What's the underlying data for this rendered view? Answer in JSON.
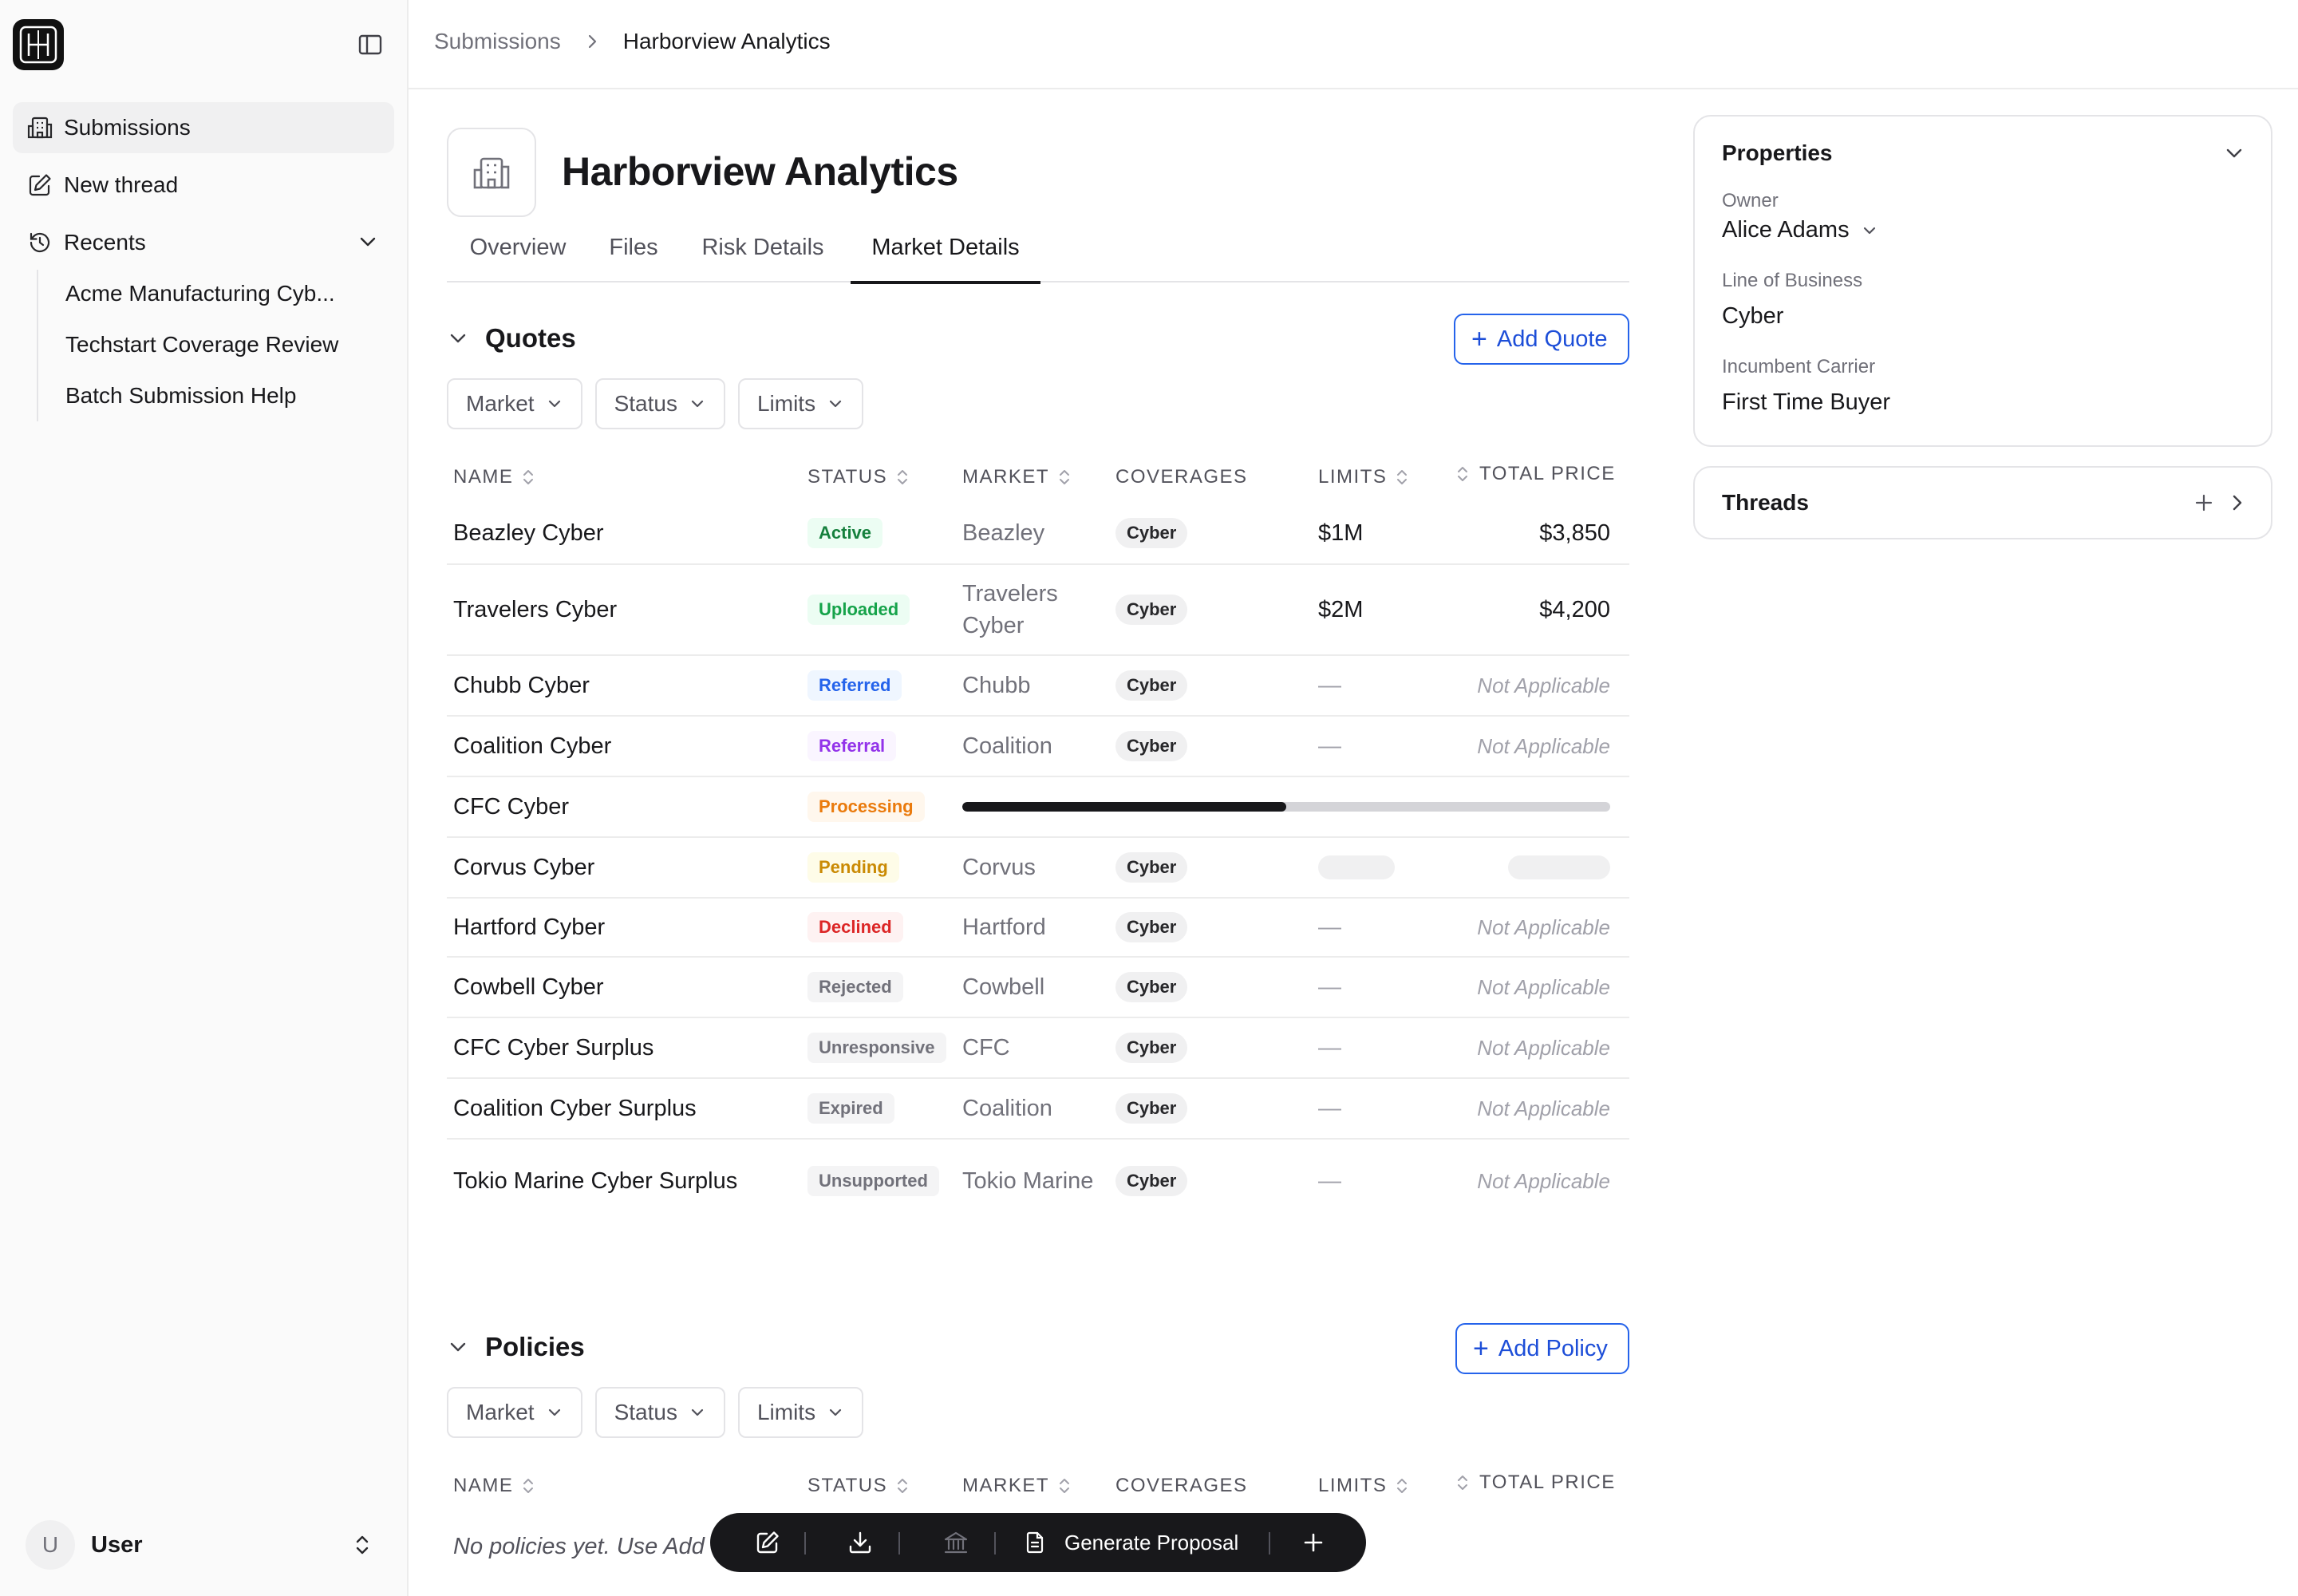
{
  "sidebar": {
    "nav": [
      {
        "label": "Submissions",
        "icon": "building-icon"
      },
      {
        "label": "New thread",
        "icon": "edit-icon"
      },
      {
        "label": "Recents",
        "icon": "history-icon"
      }
    ],
    "recents": [
      "Acme Manufacturing Cyb...",
      "Techstart Coverage Review",
      "Batch Submission Help"
    ],
    "user": {
      "initial": "U",
      "name": "User"
    }
  },
  "breadcrumb": {
    "parent": "Submissions",
    "current": "Harborview Analytics"
  },
  "page": {
    "title": "Harborview Analytics",
    "tabs": [
      "Overview",
      "Files",
      "Risk Details",
      "Market Details"
    ],
    "active_tab": "Market Details"
  },
  "quotes": {
    "title": "Quotes",
    "add_label": "Add Quote",
    "filters": [
      "Market",
      "Status",
      "Limits"
    ],
    "columns": [
      "NAME",
      "STATUS",
      "MARKET",
      "COVERAGES",
      "LIMITS",
      "TOTAL PRICE"
    ],
    "rows": [
      {
        "name": "Beazley Cyber",
        "status": "Active",
        "market": "Beazley",
        "coverage": "Cyber",
        "limits": "$1M",
        "price": "$3,850"
      },
      {
        "name": "Travelers Cyber",
        "status": "Uploaded",
        "market": "Travelers Cyber",
        "coverage": "Cyber",
        "limits": "$2M",
        "price": "$4,200"
      },
      {
        "name": "Chubb Cyber",
        "status": "Referred",
        "market": "Chubb",
        "coverage": "Cyber",
        "limits": "—",
        "price": "Not Applicable"
      },
      {
        "name": "Coalition Cyber",
        "status": "Referral",
        "market": "Coalition",
        "coverage": "Cyber",
        "limits": "—",
        "price": "Not Applicable"
      },
      {
        "name": "CFC Cyber",
        "status": "Processing",
        "progress": 0.5
      },
      {
        "name": "Corvus Cyber",
        "status": "Pending",
        "market": "Corvus",
        "coverage": "Cyber"
      },
      {
        "name": "Hartford Cyber",
        "status": "Declined",
        "market": "Hartford",
        "coverage": "Cyber",
        "limits": "—",
        "price": "Not Applicable"
      },
      {
        "name": "Cowbell Cyber",
        "status": "Rejected",
        "market": "Cowbell",
        "coverage": "Cyber",
        "limits": "—",
        "price": "Not Applicable"
      },
      {
        "name": "CFC Cyber Surplus",
        "status": "Unresponsive",
        "market": "CFC",
        "coverage": "Cyber",
        "limits": "—",
        "price": "Not Applicable"
      },
      {
        "name": "Coalition Cyber Surplus",
        "status": "Expired",
        "market": "Coalition",
        "coverage": "Cyber",
        "limits": "—",
        "price": "Not Applicable"
      },
      {
        "name": "Tokio Marine Cyber Surplus",
        "status": "Unsupported",
        "market": "Tokio Marine",
        "coverage": "Cyber",
        "limits": "—",
        "price": "Not Applicable"
      }
    ]
  },
  "status_colors": {
    "Active": {
      "bg": "#ecfdf3",
      "fg": "#15803d"
    },
    "Uploaded": {
      "bg": "#ecfdf3",
      "fg": "#16a34a"
    },
    "Referred": {
      "bg": "#eff6ff",
      "fg": "#2563eb"
    },
    "Referral": {
      "bg": "#faf5ff",
      "fg": "#9333ea"
    },
    "Processing": {
      "bg": "#fff7ed",
      "fg": "#ea7a0c"
    },
    "Pending": {
      "bg": "#fefce8",
      "fg": "#ca8a04"
    },
    "Declined": {
      "bg": "#fef2f2",
      "fg": "#dc2626"
    },
    "Rejected": {
      "bg": "#f4f4f5",
      "fg": "#71717a"
    },
    "Unresponsive": {
      "bg": "#f4f4f5",
      "fg": "#71717a"
    },
    "Expired": {
      "bg": "#f4f4f5",
      "fg": "#71717a"
    },
    "Unsupported": {
      "bg": "#f4f4f5",
      "fg": "#71717a"
    }
  },
  "policies": {
    "title": "Policies",
    "add_label": "Add Policy",
    "filters": [
      "Market",
      "Status",
      "Limits"
    ],
    "columns": [
      "NAME",
      "STATUS",
      "MARKET",
      "COVERAGES",
      "LIMITS",
      "TOTAL PRICE"
    ],
    "empty_text": "No policies yet. Use Add"
  },
  "properties": {
    "title": "Properties",
    "owner_label": "Owner",
    "owner": "Alice Adams",
    "lob_label": "Line of Business",
    "lob": "Cyber",
    "carrier_label": "Incumbent Carrier",
    "carrier": "First Time Buyer"
  },
  "threads": {
    "title": "Threads"
  },
  "toolbar": {
    "generate_label": "Generate Proposal",
    "icons": [
      "edit-icon",
      "download-icon",
      "bank-icon",
      "document-icon",
      "plus-icon"
    ]
  },
  "accent_color": "#2563eb"
}
